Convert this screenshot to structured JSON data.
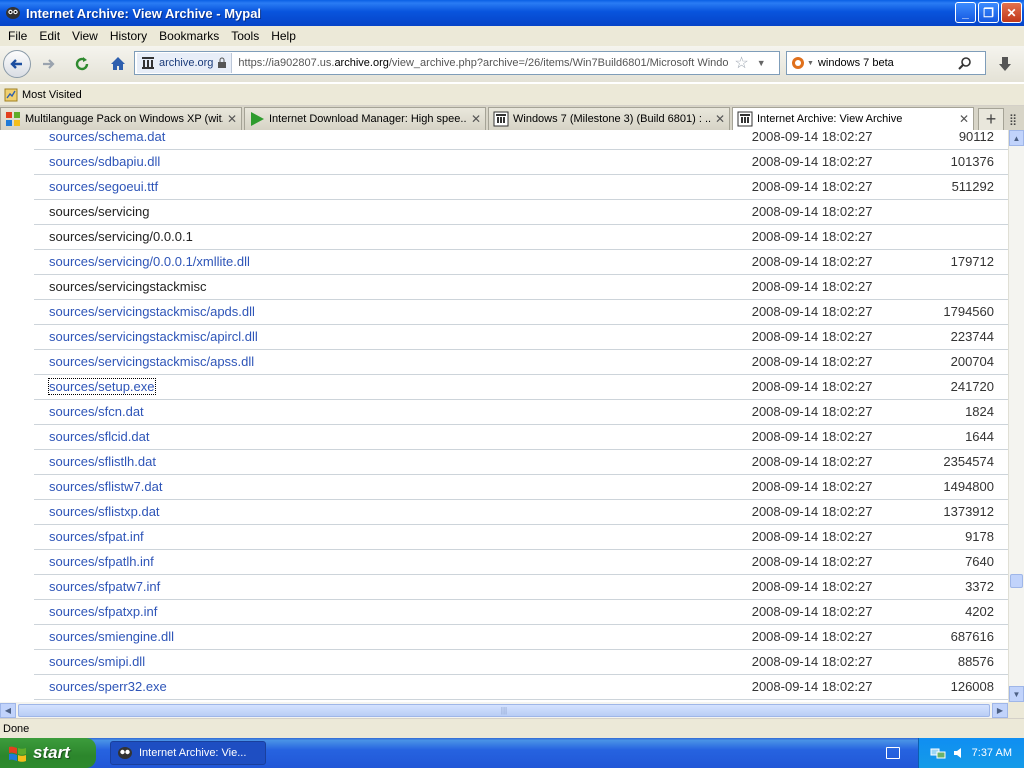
{
  "window": {
    "title": "Internet Archive: View Archive - Mypal",
    "minimize": "_",
    "maximize": "❐",
    "close": "✕"
  },
  "menu": [
    "File",
    "Edit",
    "View",
    "History",
    "Bookmarks",
    "Tools",
    "Help"
  ],
  "nav": {
    "site_identity": "archive.org",
    "url_prefix": "https://ia902807.us.",
    "url_domain": "archive.org",
    "url_suffix": "/view_archive.php?archive=/26/items/Win7Build6801/Microsoft Windov",
    "search_value": "windows 7 beta"
  },
  "bookmarks": {
    "most_visited": "Most Visited"
  },
  "tabs": [
    {
      "label": "Multilanguage Pack on Windows XP (wit...",
      "active": false
    },
    {
      "label": "Internet Download Manager: High spee...",
      "active": false
    },
    {
      "label": "Windows 7 (Milestone 3) (Build 6801) : ...",
      "active": false
    },
    {
      "label": "Internet Archive: View Archive",
      "active": true
    }
  ],
  "files": [
    {
      "name": "sources/schema.dat",
      "date": "2008-09-14 18:02:27",
      "size": "90112",
      "link": true
    },
    {
      "name": "sources/sdbapiu.dll",
      "date": "2008-09-14 18:02:27",
      "size": "101376",
      "link": true
    },
    {
      "name": "sources/segoeui.ttf",
      "date": "2008-09-14 18:02:27",
      "size": "511292",
      "link": true
    },
    {
      "name": "sources/servicing",
      "date": "2008-09-14 18:02:27",
      "size": "",
      "link": false
    },
    {
      "name": "sources/servicing/0.0.0.1",
      "date": "2008-09-14 18:02:27",
      "size": "",
      "link": false
    },
    {
      "name": "sources/servicing/0.0.0.1/xmllite.dll",
      "date": "2008-09-14 18:02:27",
      "size": "179712",
      "link": true
    },
    {
      "name": "sources/servicingstackmisc",
      "date": "2008-09-14 18:02:27",
      "size": "",
      "link": false
    },
    {
      "name": "sources/servicingstackmisc/apds.dll",
      "date": "2008-09-14 18:02:27",
      "size": "1794560",
      "link": true
    },
    {
      "name": "sources/servicingstackmisc/apircl.dll",
      "date": "2008-09-14 18:02:27",
      "size": "223744",
      "link": true
    },
    {
      "name": "sources/servicingstackmisc/apss.dll",
      "date": "2008-09-14 18:02:27",
      "size": "200704",
      "link": true
    },
    {
      "name": "sources/setup.exe",
      "date": "2008-09-14 18:02:27",
      "size": "241720",
      "link": true,
      "focused": true
    },
    {
      "name": "sources/sfcn.dat",
      "date": "2008-09-14 18:02:27",
      "size": "1824",
      "link": true
    },
    {
      "name": "sources/sflcid.dat",
      "date": "2008-09-14 18:02:27",
      "size": "1644",
      "link": true
    },
    {
      "name": "sources/sflistlh.dat",
      "date": "2008-09-14 18:02:27",
      "size": "2354574",
      "link": true
    },
    {
      "name": "sources/sflistw7.dat",
      "date": "2008-09-14 18:02:27",
      "size": "1494800",
      "link": true
    },
    {
      "name": "sources/sflistxp.dat",
      "date": "2008-09-14 18:02:27",
      "size": "1373912",
      "link": true
    },
    {
      "name": "sources/sfpat.inf",
      "date": "2008-09-14 18:02:27",
      "size": "9178",
      "link": true
    },
    {
      "name": "sources/sfpatlh.inf",
      "date": "2008-09-14 18:02:27",
      "size": "7640",
      "link": true
    },
    {
      "name": "sources/sfpatw7.inf",
      "date": "2008-09-14 18:02:27",
      "size": "3372",
      "link": true
    },
    {
      "name": "sources/sfpatxp.inf",
      "date": "2008-09-14 18:02:27",
      "size": "4202",
      "link": true
    },
    {
      "name": "sources/smiengine.dll",
      "date": "2008-09-14 18:02:27",
      "size": "687616",
      "link": true
    },
    {
      "name": "sources/smipi.dll",
      "date": "2008-09-14 18:02:27",
      "size": "88576",
      "link": true
    },
    {
      "name": "sources/sperr32.exe",
      "date": "2008-09-14 18:02:27",
      "size": "126008",
      "link": true
    }
  ],
  "status": "Done",
  "taskbar": {
    "start": "start",
    "task_label": "Internet Archive: Vie...",
    "clock": "7:37 AM"
  },
  "colors": {
    "link": "#2e55b8",
    "titlebar": "#0854dd",
    "taskbar": "#2157d7",
    "start": "#2c862c"
  }
}
